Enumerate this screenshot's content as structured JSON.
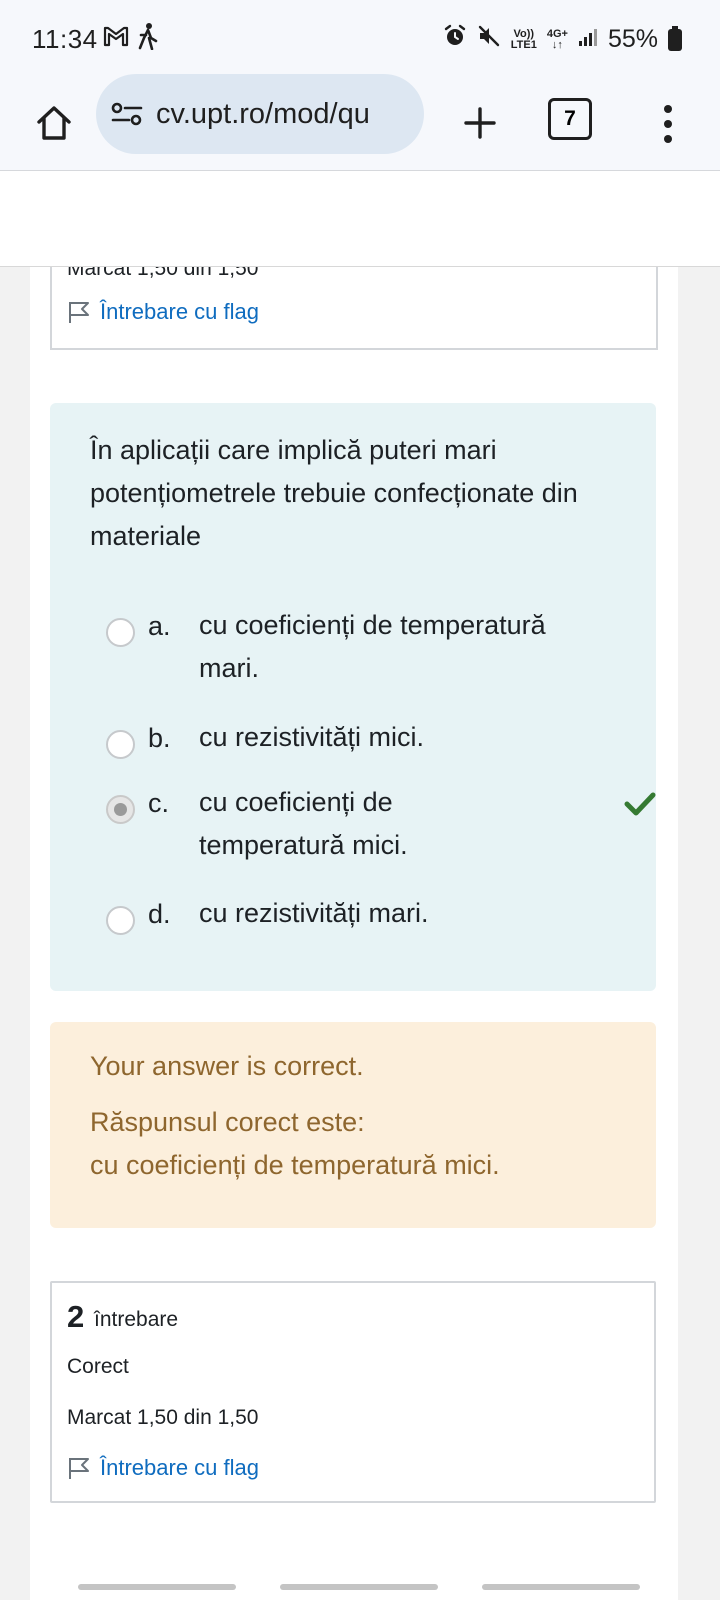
{
  "status_bar": {
    "time": "11:34",
    "net_top": "Vo))",
    "net_bottom": "LTE1",
    "net_type": "4G+",
    "battery": "55%"
  },
  "browser": {
    "url": "cv.upt.ro/mod/qu",
    "tab_count": "7"
  },
  "previous_question": {
    "marks_partial": "Marcat 1,50 din 1,50",
    "flag_label": "Întrebare cu flag"
  },
  "question": {
    "text": "În aplicații care implică puteri mari potențiometrele trebuie confecționate din materiale",
    "options": [
      {
        "letter": "a.",
        "text": "cu coeficienți de temperatură mari.",
        "selected": false
      },
      {
        "letter": "b.",
        "text": "cu rezistivități mici.",
        "selected": false
      },
      {
        "letter": "c.",
        "text": "cu coeficienți de temperatură mici.",
        "selected": true,
        "correct": true
      },
      {
        "letter": "d.",
        "text": "cu rezistivități mari.",
        "selected": false
      }
    ]
  },
  "feedback": {
    "result": "Your answer is correct.",
    "correct_label": "Răspunsul corect este:",
    "correct_answer": "cu coeficienți de temperatură mici."
  },
  "next_question": {
    "number": "2",
    "word": "întrebare",
    "state": "Corect",
    "marks": "Marcat 1,50 din 1,50",
    "flag_label": "Întrebare cu flag"
  },
  "colors": {
    "link": "#0f6cbf",
    "question_bg": "#e7f3f5",
    "feedback_bg": "#fcefdc",
    "feedback_text": "#8e662e",
    "check": "#357a32"
  }
}
